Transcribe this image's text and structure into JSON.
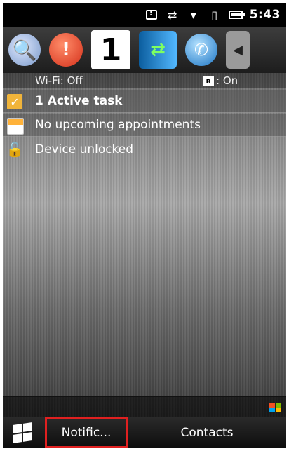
{
  "status_bar": {
    "time": "5:43",
    "icons": [
      "notification-icon",
      "data-sync-icon",
      "signal-icon",
      "vibrate-icon",
      "battery-icon"
    ]
  },
  "launcher": {
    "apps": [
      {
        "name": "search-icon",
        "glyph": "🔍"
      },
      {
        "name": "missed-call-icon",
        "glyph": "!"
      },
      {
        "name": "notification-count-icon",
        "glyph": "1"
      },
      {
        "name": "activesync-icon",
        "glyph": "⇄"
      },
      {
        "name": "phone-icon",
        "glyph": "✆"
      },
      {
        "name": "more-icon",
        "glyph": "◀"
      }
    ]
  },
  "connectivity": {
    "wifi_label": "Wi-Fi: Off",
    "bluetooth_label": ": On"
  },
  "rows": {
    "tasks": "1 Active task",
    "appointments": "No upcoming appointments",
    "device": "Device unlocked"
  },
  "softkeys": {
    "left": "Notific...",
    "right": "Contacts"
  },
  "colors": {
    "highlight_border": "#e02020",
    "accent_yellow": "#f0b43a"
  }
}
